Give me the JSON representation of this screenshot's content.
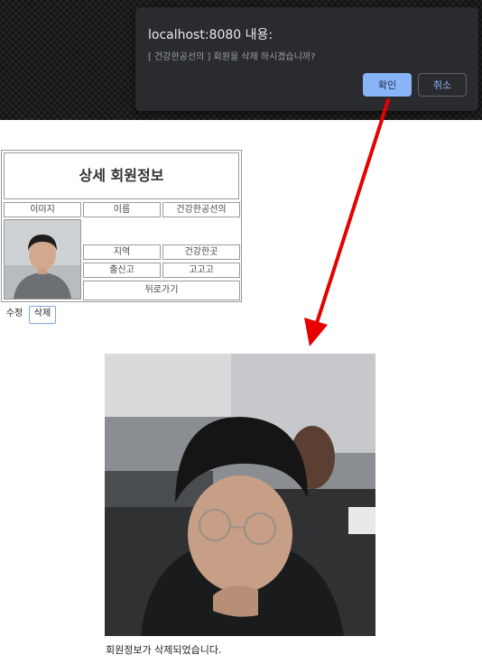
{
  "alert": {
    "title": "localhost:8080 내용:",
    "message": "[ 건강한공선의 ] 회원을 삭제 하시겠습니까?",
    "ok_label": "확인",
    "cancel_label": "취소"
  },
  "detail": {
    "title": "상세 회원정보",
    "image_label": "이미지",
    "name_label": "이름",
    "name_value": "건강한공선의",
    "region_label": "지역",
    "region_value": "건강한곳",
    "school_label": "출신고",
    "school_value": "고고고",
    "back_label": "뒤로가기"
  },
  "actions": {
    "edit_label": "수정",
    "delete_label": "삭제"
  },
  "result": {
    "message": "회원정보가 삭제되었습니다."
  },
  "colors": {
    "dialog_bg": "#2a2b2e",
    "ok_button": "#8ab4f8",
    "arrow": "#e60000"
  }
}
